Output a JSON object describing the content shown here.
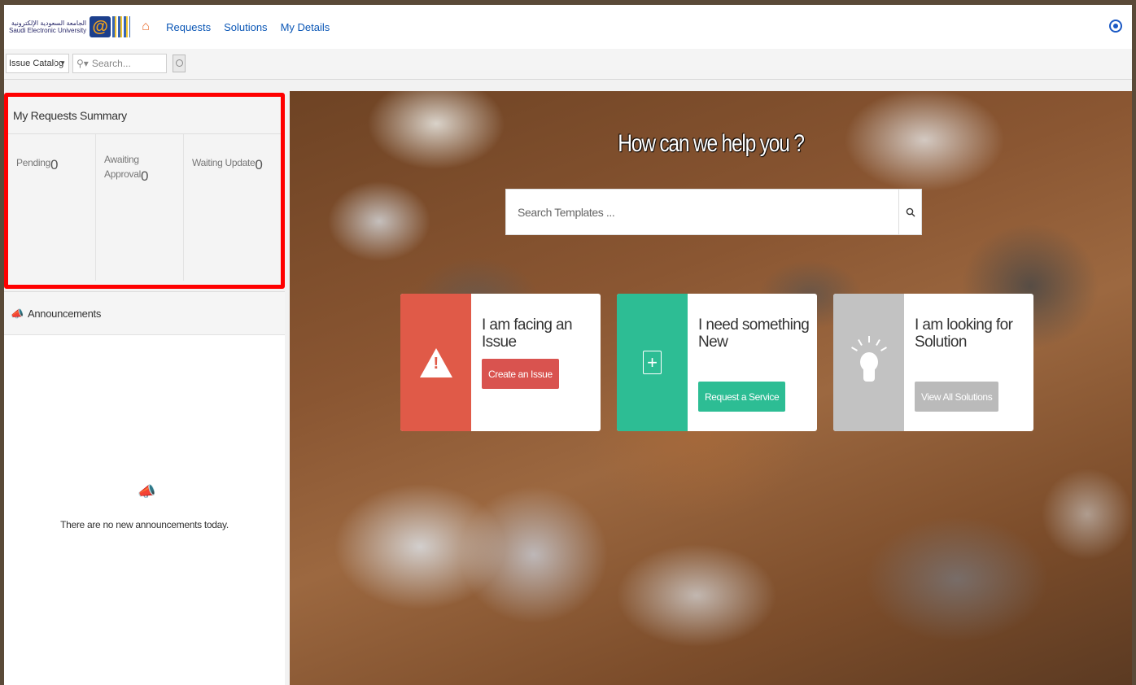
{
  "header": {
    "logo_text_ar": "الجامعة السعودية الإلكترونية",
    "logo_text_en": "Saudi Electronic University",
    "logo_mark": "@",
    "nav": [
      "Requests",
      "Solutions",
      "My Details"
    ]
  },
  "toolbar": {
    "catalog_value": "Issue Catalog",
    "search_placeholder": "Search..."
  },
  "summary": {
    "title": "My Requests Summary",
    "stats": [
      {
        "label": "Pending",
        "count": "0"
      },
      {
        "label": "Awaiting Approval",
        "count": "0"
      },
      {
        "label": "Waiting Update",
        "count": "0"
      }
    ]
  },
  "announcements": {
    "title": "Announcements",
    "empty_text": "There are no new announcements today."
  },
  "hero": {
    "title": "How can we help you ?",
    "search_placeholder": "Search Templates ...",
    "cards": [
      {
        "title": "I am facing an Issue",
        "cta": "Create an Issue",
        "color": "#e05a48"
      },
      {
        "title": "I need something New",
        "cta": "Request a Service",
        "color": "#2dbd94"
      },
      {
        "title": "I am looking for Solution",
        "cta": "View All Solutions",
        "color": "#c2c2c2"
      }
    ]
  },
  "icons": [
    "home-icon",
    "user-icon",
    "search-icon",
    "megaphone-icon",
    "warning-icon",
    "plus-icon",
    "lightbulb-icon"
  ]
}
